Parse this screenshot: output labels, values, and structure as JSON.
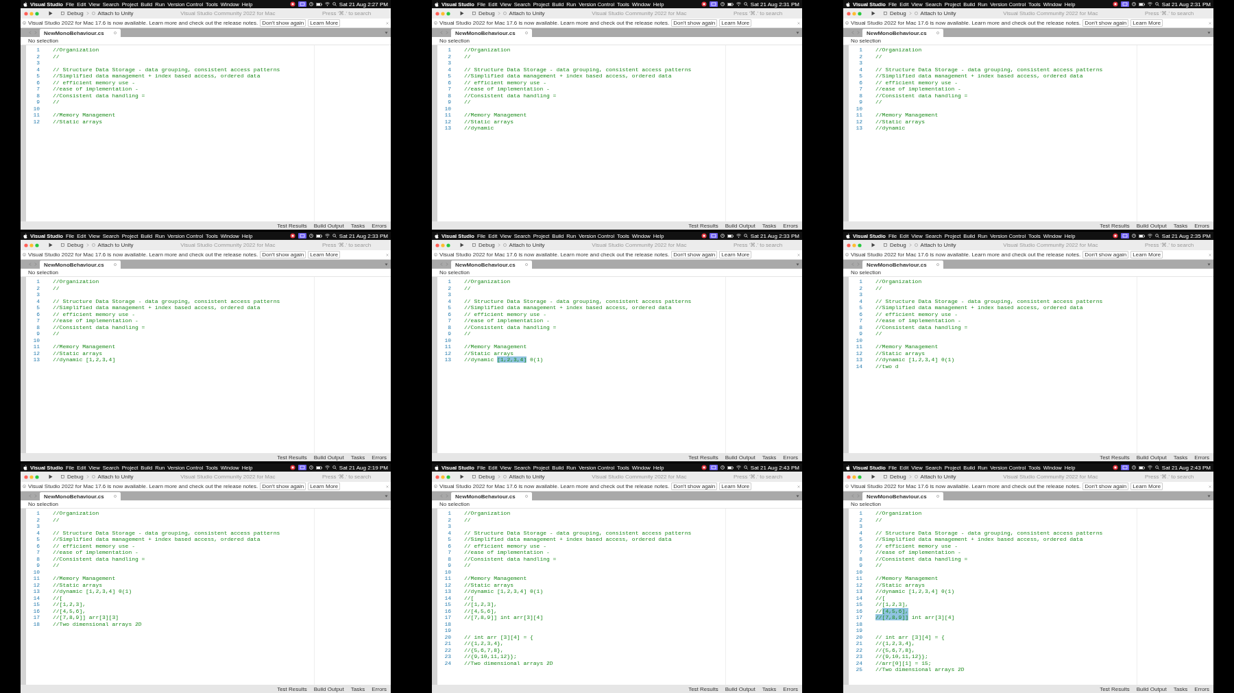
{
  "screens": [
    {
      "menu": [
        "Visual Studio",
        "File",
        "Edit",
        "View",
        "Search",
        "Project",
        "Build",
        "Run",
        "Version Control",
        "Tools",
        "Window",
        "Help"
      ],
      "clock": "Sat 21 Aug 2:27 PM",
      "scheme": "Debug",
      "target": "Attach to Unity",
      "title": "Visual Studio Community 2022 for Mac",
      "search": {
        "placeholder": "Press '⌘.' to search"
      },
      "notice": {
        "text": "Visual Studio 2022 for Mac 17.6 is now available. Learn more and check out the release notes.",
        "buttons": [
          "Don't show again",
          "Learn More"
        ]
      },
      "tab": {
        "label": "NewMonoBehaviour.cs"
      },
      "breadcrumb": "No selection",
      "status_items": [
        "Test Results",
        "Build Output",
        "Tasks",
        "Errors"
      ],
      "lines": [
        {
          "number": "1",
          "text": "//Organization"
        },
        {
          "number": "2",
          "text": "//"
        },
        {
          "number": "3"
        },
        {
          "number": "4",
          "text": "// Structure Data Storage - data grouping, consistent access patterns"
        },
        {
          "number": "5",
          "text": "//Simplified data management + index based access, ordered data"
        },
        {
          "number": "6",
          "text": "// efficient memory use -"
        },
        {
          "number": "7",
          "text": "//ease of implementation -"
        },
        {
          "number": "8",
          "text": "//Consistent data handling ="
        },
        {
          "number": "9",
          "text": "//"
        },
        {
          "number": "10"
        },
        {
          "number": "11",
          "text": "//Memory Management"
        },
        {
          "number": "12",
          "text": "//Static arrays"
        }
      ]
    },
    {
      "menu": [
        "Visual Studio",
        "File",
        "Edit",
        "View",
        "Search",
        "Project",
        "Build",
        "Run",
        "Version Control",
        "Tools",
        "Window",
        "Help"
      ],
      "clock": "Sat 21 Aug 2:31 PM",
      "scheme": "Debug",
      "target": "Attach to Unity",
      "title": "Visual Studio Community 2022 for Mac",
      "search": {
        "placeholder": "Press '⌘.' to search"
      },
      "notice": {
        "text": "Visual Studio 2022 for Mac 17.6 is now available. Learn more and check out the release notes.",
        "buttons": [
          "Don't show again",
          "Learn More"
        ]
      },
      "tab": {
        "label": "NewMonoBehaviour.cs"
      },
      "breadcrumb": "No selection",
      "status_items": [
        "Test Results",
        "Build Output",
        "Tasks",
        "Errors"
      ],
      "lines": [
        {
          "number": "1",
          "text": "//Organization"
        },
        {
          "number": "2",
          "text": "//"
        },
        {
          "number": "3"
        },
        {
          "number": "4",
          "text": "// Structure Data Storage - data grouping, consistent access patterns"
        },
        {
          "number": "5",
          "text": "//Simplified data management + index based access, ordered data"
        },
        {
          "number": "6",
          "text": "// efficient memory use -"
        },
        {
          "number": "7",
          "text": "//ease of implementation -"
        },
        {
          "number": "8",
          "text": "//Consistent data handling ="
        },
        {
          "number": "9",
          "text": "//"
        },
        {
          "number": "10"
        },
        {
          "number": "11",
          "text": "//Memory Management"
        },
        {
          "number": "12",
          "text": "//Static arrays"
        },
        {
          "number": "13",
          "text": "//dynamic"
        }
      ]
    },
    {
      "menu": [
        "Visual Studio",
        "File",
        "Edit",
        "View",
        "Search",
        "Project",
        "Build",
        "Run",
        "Version Control",
        "Tools",
        "Window",
        "Help"
      ],
      "clock": "Sat 21 Aug 2:31 PM",
      "scheme": "Debug",
      "target": "Attach to Unity",
      "title": "Visual Studio Community 2022 for Mac",
      "search": {
        "placeholder": "Press '⌘.' to search"
      },
      "notice": {
        "text": "Visual Studio 2022 for Mac 17.6 is now available. Learn more and check out the release notes.",
        "buttons": [
          "Don't show again",
          "Learn More"
        ]
      },
      "tab": {
        "label": "NewMonoBehaviour.cs"
      },
      "breadcrumb": "No selection",
      "status_items": [
        "Test Results",
        "Build Output",
        "Tasks",
        "Errors"
      ],
      "lines": [
        {
          "number": "1",
          "text": "//Organization"
        },
        {
          "number": "2",
          "text": "//"
        },
        {
          "number": "3"
        },
        {
          "number": "4",
          "text": "// Structure Data Storage - data grouping, consistent access patterns"
        },
        {
          "number": "5",
          "text": "//Simplified data management + index based access, ordered data"
        },
        {
          "number": "6",
          "text": "// efficient memory use -"
        },
        {
          "number": "7",
          "text": "//ease of implementation -"
        },
        {
          "number": "8",
          "text": "//Consistent data handling ="
        },
        {
          "number": "9",
          "text": "//"
        },
        {
          "number": "10"
        },
        {
          "number": "11",
          "text": "//Memory Management"
        },
        {
          "number": "12",
          "text": "//Static arrays"
        },
        {
          "number": "13",
          "text": "//dynamic"
        }
      ]
    },
    {
      "menu": [
        "Visual Studio",
        "File",
        "Edit",
        "View",
        "Search",
        "Project",
        "Build",
        "Run",
        "Version Control",
        "Tools",
        "Window",
        "Help"
      ],
      "clock": "Sat 21 Aug 2:33 PM",
      "scheme": "Debug",
      "target": "Attach to Unity",
      "title": "Visual Studio Community 2022 for Mac",
      "search": {
        "placeholder": "Press '⌘.' to search"
      },
      "notice": {
        "text": "Visual Studio 2022 for Mac 17.6 is now available. Learn more and check out the release notes.",
        "buttons": [
          "Don't show again",
          "Learn More"
        ]
      },
      "tab": {
        "label": "NewMonoBehaviour.cs"
      },
      "breadcrumb": "No selection",
      "status_items": [
        "Test Results",
        "Build Output",
        "Tasks",
        "Errors"
      ],
      "lines": [
        {
          "number": "1",
          "text": "//Organization"
        },
        {
          "number": "2",
          "text": "//"
        },
        {
          "number": "3"
        },
        {
          "number": "4",
          "text": "// Structure Data Storage - data grouping, consistent access patterns"
        },
        {
          "number": "5",
          "text": "//Simplified data management + index based access, ordered data"
        },
        {
          "number": "6",
          "text": "// efficient memory use -"
        },
        {
          "number": "7",
          "text": "//ease of implementation -"
        },
        {
          "number": "8",
          "text": "//Consistent data handling ="
        },
        {
          "number": "9",
          "text": "//"
        },
        {
          "number": "10"
        },
        {
          "number": "11",
          "text": "//Memory Management"
        },
        {
          "number": "12",
          "text": "//Static arrays"
        },
        {
          "number": "13",
          "text": "//dynamic [1,2,3,4]"
        }
      ]
    },
    {
      "menu": [
        "Visual Studio",
        "File",
        "Edit",
        "View",
        "Search",
        "Project",
        "Build",
        "Run",
        "Version Control",
        "Tools",
        "Window",
        "Help"
      ],
      "clock": "Sat 21 Aug 2:33 PM",
      "scheme": "Debug",
      "target": "Attach to Unity",
      "title": "Visual Studio Community 2022 for Mac",
      "search": {
        "placeholder": "Press '⌘.' to search"
      },
      "notice": {
        "text": "Visual Studio 2022 for Mac 17.6 is now available. Learn more and check out the release notes.",
        "buttons": [
          "Don't show again",
          "Learn More"
        ]
      },
      "tab": {
        "label": "NewMonoBehaviour.cs"
      },
      "breadcrumb": "No selection",
      "status_items": [
        "Test Results",
        "Build Output",
        "Tasks",
        "Errors"
      ],
      "lines": [
        {
          "number": "1",
          "text": "//Organization"
        },
        {
          "number": "2",
          "text": "//"
        },
        {
          "number": "3"
        },
        {
          "number": "4",
          "text": "// Structure Data Storage - data grouping, consistent access patterns"
        },
        {
          "number": "5",
          "text": "//Simplified data management + index based access, ordered data"
        },
        {
          "number": "6",
          "text": "// efficient memory use -"
        },
        {
          "number": "7",
          "text": "//ease of implementation -"
        },
        {
          "number": "8",
          "text": "//Consistent data handling ="
        },
        {
          "number": "9",
          "text": "//"
        },
        {
          "number": "10"
        },
        {
          "number": "11",
          "text": "//Memory Management"
        },
        {
          "number": "12",
          "text": "//Static arrays"
        },
        {
          "number": "13",
          "parts": [
            {
              "text": "//dynamic ",
              "selected": false
            },
            {
              "text": "[1,2,3,4]",
              "selected": true
            },
            {
              "text": " 0(1)",
              "selected": false
            }
          ]
        }
      ]
    },
    {
      "menu": [
        "Visual Studio",
        "File",
        "Edit",
        "View",
        "Search",
        "Project",
        "Build",
        "Run",
        "Version Control",
        "Tools",
        "Window",
        "Help"
      ],
      "clock": "Sat 21 Aug 2:35 PM",
      "scheme": "Debug",
      "target": "Attach to Unity",
      "title": "Visual Studio Community 2022 for Mac",
      "search": {
        "placeholder": "Press '⌘.' to search"
      },
      "notice": {
        "text": "Visual Studio 2022 for Mac 17.6 is now available. Learn more and check out the release notes.",
        "buttons": [
          "Don't show again",
          "Learn More"
        ]
      },
      "tab": {
        "label": "NewMonoBehaviour.cs"
      },
      "breadcrumb": "No selection",
      "status_items": [
        "Test Results",
        "Build Output",
        "Tasks",
        "Errors"
      ],
      "lines": [
        {
          "number": "1",
          "text": "//Organization"
        },
        {
          "number": "2",
          "text": "//"
        },
        {
          "number": "3"
        },
        {
          "number": "4",
          "text": "// Structure Data Storage - data grouping, consistent access patterns"
        },
        {
          "number": "5",
          "text": "//Simplified data management + index based access, ordered data"
        },
        {
          "number": "6",
          "text": "// efficient memory use -"
        },
        {
          "number": "7",
          "text": "//ease of implementation -"
        },
        {
          "number": "8",
          "text": "//Consistent data handling ="
        },
        {
          "number": "9",
          "text": "//"
        },
        {
          "number": "10"
        },
        {
          "number": "11",
          "text": "//Memory Management"
        },
        {
          "number": "12",
          "text": "//Static arrays"
        },
        {
          "number": "13",
          "text": "//dynamic [1,2,3,4] 0(1)"
        },
        {
          "number": "14",
          "text": "//two d"
        }
      ]
    },
    {
      "menu": [
        "Visual Studio",
        "File",
        "Edit",
        "View",
        "Search",
        "Project",
        "Build",
        "Run",
        "Version Control",
        "Tools",
        "Window",
        "Help"
      ],
      "clock": "Sat 21 Aug 2:19 PM",
      "scheme": "Debug",
      "target": "Attach to Unity",
      "title": "Visual Studio Community 2022 for Mac",
      "search": {
        "placeholder": "Press '⌘.' to search"
      },
      "notice": {
        "text": "Visual Studio 2022 for Mac 17.6 is now available. Learn more and check out the release notes.",
        "buttons": [
          "Don't show again",
          "Learn More"
        ]
      },
      "tab": {
        "label": "NewMonoBehaviour.cs"
      },
      "breadcrumb": "No selection",
      "status_items": [
        "Test Results",
        "Build Output",
        "Tasks",
        "Errors"
      ],
      "lines": [
        {
          "number": "1",
          "text": "//Organization"
        },
        {
          "number": "2",
          "text": "//"
        },
        {
          "number": "3"
        },
        {
          "number": "4",
          "text": "// Structure Data Storage - data grouping, consistent access patterns"
        },
        {
          "number": "5",
          "text": "//Simplified data management + index based access, ordered data"
        },
        {
          "number": "6",
          "text": "// efficient memory use -"
        },
        {
          "number": "7",
          "text": "//ease of implementation -"
        },
        {
          "number": "8",
          "text": "//Consistent data handling ="
        },
        {
          "number": "9",
          "text": "//"
        },
        {
          "number": "10"
        },
        {
          "number": "11",
          "text": "//Memory Management"
        },
        {
          "number": "12",
          "text": "//Static arrays"
        },
        {
          "number": "13",
          "text": "//dynamic [1,2,3,4] 0(1)"
        },
        {
          "number": "14",
          "text": "//["
        },
        {
          "number": "15",
          "text": "//[1,2,3],"
        },
        {
          "number": "16",
          "text": "//[4,5,6],"
        },
        {
          "number": "17",
          "text": "//[7,8,9]] arr[3][3]"
        },
        {
          "number": "18",
          "text": "//Two dimensional arrays 2D"
        }
      ]
    },
    {
      "menu": [
        "Visual Studio",
        "File",
        "Edit",
        "View",
        "Search",
        "Project",
        "Build",
        "Run",
        "Version Control",
        "Tools",
        "Window",
        "Help"
      ],
      "clock": "Sat 21 Aug 2:43 PM",
      "scheme": "Debug",
      "target": "Attach to Unity",
      "title": "Visual Studio Community 2022 for Mac",
      "search": {
        "placeholder": "Press '⌘.' to search"
      },
      "notice": {
        "text": "Visual Studio 2022 for Mac 17.6 is now available. Learn more and check out the release notes.",
        "buttons": [
          "Don't show again",
          "Learn More"
        ]
      },
      "tab": {
        "label": "NewMonoBehaviour.cs"
      },
      "breadcrumb": "No selection",
      "status_items": [
        "Test Results",
        "Build Output",
        "Tasks",
        "Errors"
      ],
      "lines": [
        {
          "number": "1",
          "text": "//Organization"
        },
        {
          "number": "2",
          "text": "//"
        },
        {
          "number": "3"
        },
        {
          "number": "4",
          "text": "// Structure Data Storage - data grouping, consistent access patterns"
        },
        {
          "number": "5",
          "text": "//Simplified data management + index based access, ordered data"
        },
        {
          "number": "6",
          "text": "// efficient memory use -"
        },
        {
          "number": "7",
          "text": "//ease of implementation -"
        },
        {
          "number": "8",
          "text": "//Consistent data handling ="
        },
        {
          "number": "9",
          "text": "//"
        },
        {
          "number": "10"
        },
        {
          "number": "11",
          "text": "//Memory Management"
        },
        {
          "number": "12",
          "text": "//Static arrays"
        },
        {
          "number": "13",
          "text": "//dynamic [1,2,3,4] 0(1)"
        },
        {
          "number": "14",
          "text": "//["
        },
        {
          "number": "15",
          "text": "//[1,2,3],"
        },
        {
          "number": "16",
          "text": "//[4,5,6],"
        },
        {
          "number": "17",
          "text": "//[7,8,9]] int arr[3][4]"
        },
        {
          "number": "18"
        },
        {
          "number": "19"
        },
        {
          "number": "20",
          "text": "// int arr [3][4] = {"
        },
        {
          "number": "21",
          "text": "//{1,2,3,4},"
        },
        {
          "number": "22",
          "text": "//{5,6,7,8},"
        },
        {
          "number": "23",
          "text": "//{9,10,11,12}};"
        },
        {
          "number": "24",
          "text": "//Two dimensional arrays 2D"
        }
      ]
    },
    {
      "menu": [
        "Visual Studio",
        "File",
        "Edit",
        "View",
        "Search",
        "Project",
        "Build",
        "Run",
        "Version Control",
        "Tools",
        "Window",
        "Help"
      ],
      "clock": "Sat 21 Aug 2:43 PM",
      "scheme": "Debug",
      "target": "Attach to Unity",
      "title": "Visual Studio Community 2022 for Mac",
      "search": {
        "placeholder": "Press '⌘.' to search"
      },
      "notice": {
        "text": "Visual Studio 2022 for Mac 17.6 is now available. Learn more and check out the release notes.",
        "buttons": [
          "Don't show again",
          "Learn More"
        ]
      },
      "tab": {
        "label": "NewMonoBehaviour.cs"
      },
      "breadcrumb": "No selection",
      "status_items": [
        "Test Results",
        "Build Output",
        "Tasks",
        "Errors"
      ],
      "lines": [
        {
          "number": "1",
          "text": "//Organization"
        },
        {
          "number": "2",
          "text": "//"
        },
        {
          "number": "3"
        },
        {
          "number": "4",
          "text": "// Structure Data Storage - data grouping, consistent access patterns"
        },
        {
          "number": "5",
          "text": "//Simplified data management + index based access, ordered data"
        },
        {
          "number": "6",
          "text": "// efficient memory use -"
        },
        {
          "number": "7",
          "text": "//ease of implementation -"
        },
        {
          "number": "8",
          "text": "//Consistent data handling ="
        },
        {
          "number": "9",
          "text": "//"
        },
        {
          "number": "10"
        },
        {
          "number": "11",
          "text": "//Memory Management"
        },
        {
          "number": "12",
          "text": "//Static arrays"
        },
        {
          "number": "13",
          "text": "//dynamic [1,2,3,4] 0(1)"
        },
        {
          "number": "14",
          "text": "//["
        },
        {
          "number": "15",
          "text": "//[1,2,3],"
        },
        {
          "number": "16",
          "parts": [
            {
              "text": "//",
              "selected": false
            },
            {
              "text": "[4,5,6],",
              "selected": true
            }
          ]
        },
        {
          "number": "17",
          "parts": [
            {
              "text": "//[7,8,9]]",
              "selected": true
            },
            {
              "text": " int arr[3][4]",
              "selected": false
            }
          ]
        },
        {
          "number": "18"
        },
        {
          "number": "19"
        },
        {
          "number": "20",
          "text": "// int arr [3][4] = {"
        },
        {
          "number": "21",
          "text": "//{1,2,3,4},"
        },
        {
          "number": "22",
          "text": "//{5,6,7,8},"
        },
        {
          "number": "23",
          "text": "//{9,10,11,12}};"
        },
        {
          "number": "24",
          "text": "//arr[0][1] = 15;"
        },
        {
          "number": "25",
          "text": "//Two dimensional arrays 2D"
        }
      ]
    }
  ]
}
